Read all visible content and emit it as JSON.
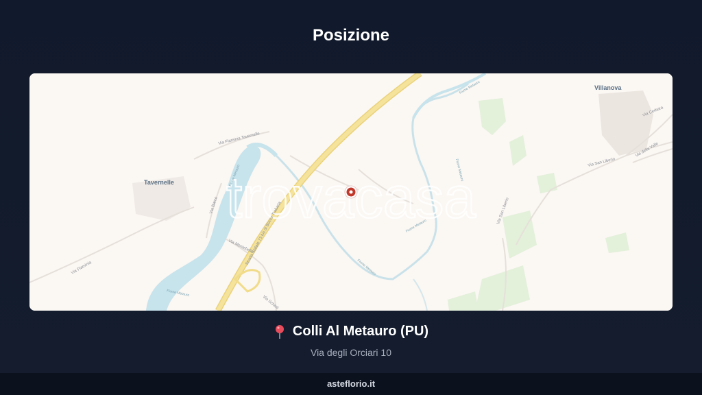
{
  "header": {
    "title": "Posizione"
  },
  "map": {
    "watermark": "trovacasa",
    "place_labels": {
      "villanova": "Villanova",
      "tavernelle": "Tavernelle"
    },
    "road_labels": {
      "via_flaminia_tavernelle": "Via Flaminia Tavernelle",
      "via_flaminia": "Via Flaminia",
      "via_barco": "Via Barco",
      "via_montebello": "Via Montebello",
      "strada_statale": "Strada Statale 73 bis di Bocca Trabaria",
      "via_san_liberio": "Via San Liberio",
      "via_cerbara": "Via Cerbara",
      "via_della_valle": "Via della Valle",
      "via_schieti": "Via Schieti"
    },
    "river_labels": {
      "fiume_metauro": "Fiume Metauro"
    },
    "colors": {
      "background": "#fbf7f3",
      "river": "#c7e3ec",
      "highway": "#f2dc8a",
      "green": "#dcefd4",
      "marker": "#c0392b"
    }
  },
  "location": {
    "icon": "pin-icon",
    "city": "Colli Al Metauro (PU)",
    "address": "Via degli Orciari 10"
  },
  "footer": {
    "site": "asteflorio.it"
  }
}
